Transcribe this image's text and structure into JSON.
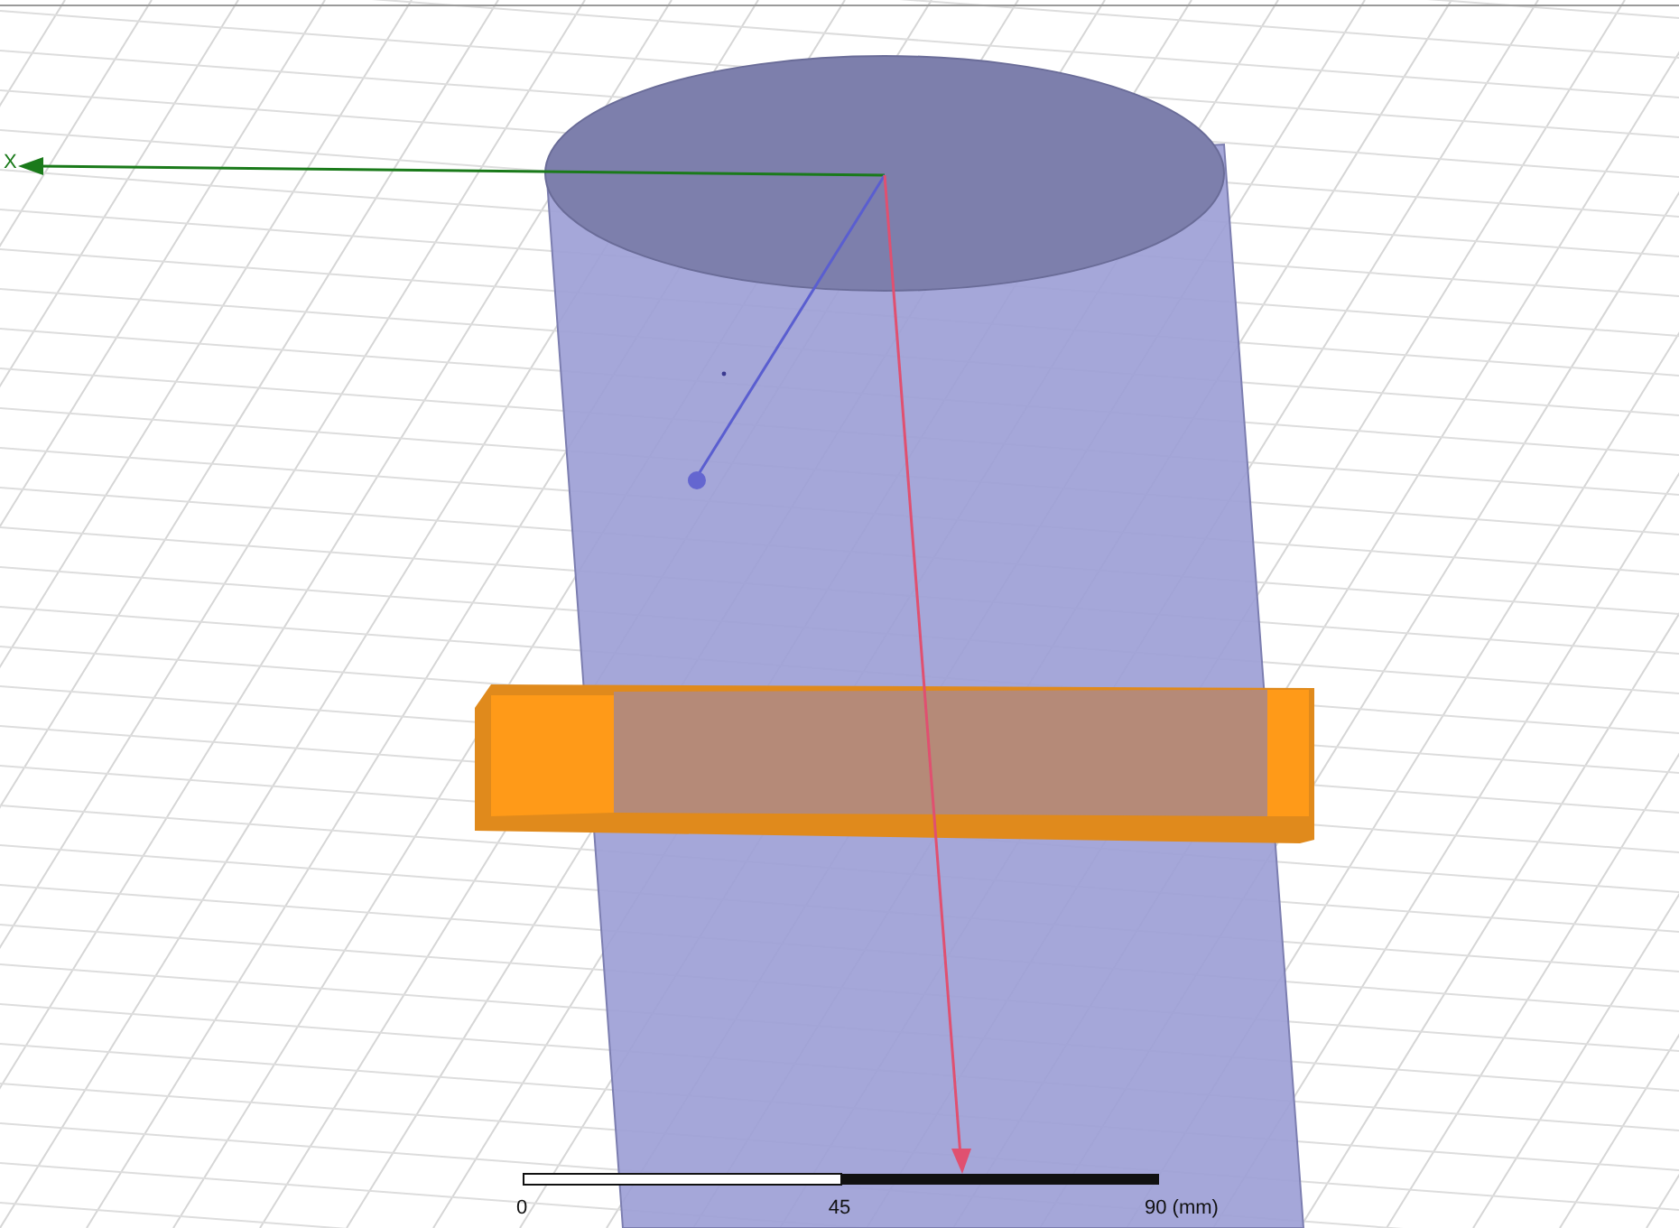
{
  "viewport": {
    "axis_label": "X"
  },
  "scale_bar": {
    "ticks": [
      "0",
      "45",
      "90 (mm)"
    ]
  }
}
